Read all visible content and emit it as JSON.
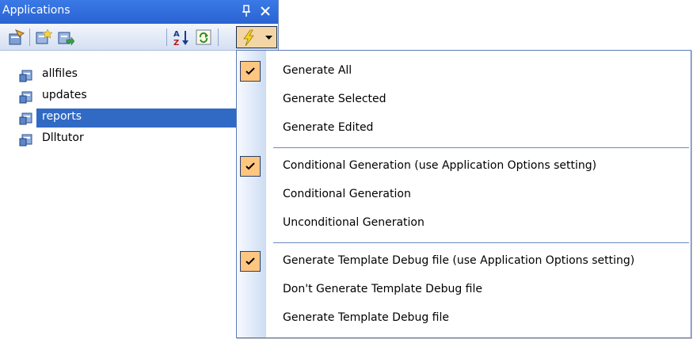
{
  "panel": {
    "title": "Applications",
    "tree_items": [
      {
        "label": "allfiles",
        "selected": false
      },
      {
        "label": "updates",
        "selected": false
      },
      {
        "label": "reports",
        "selected": true
      },
      {
        "label": "Dlltutor",
        "selected": false
      }
    ]
  },
  "toolbar": {
    "icons": [
      "properties-icon",
      "add-application-icon",
      "import-application-icon",
      "sort-az-icon",
      "refresh-icon",
      "generate-icon",
      "chevron-down-icon"
    ]
  },
  "menu": {
    "group1": [
      {
        "label": "Generate All",
        "checked": true
      },
      {
        "label": "Generate Selected",
        "checked": false
      },
      {
        "label": "Generate Edited",
        "checked": false
      }
    ],
    "group2": [
      {
        "label": "Conditional Generation (use Application Options setting)",
        "checked": true
      },
      {
        "label": "Conditional Generation",
        "checked": false
      },
      {
        "label": "Unconditional Generation",
        "checked": false
      }
    ],
    "group3": [
      {
        "label": "Generate Template Debug file (use Application Options setting)",
        "checked": true
      },
      {
        "label": "Don't Generate Template Debug file",
        "checked": false
      },
      {
        "label": "Generate Template Debug file",
        "checked": false
      }
    ]
  },
  "colors": {
    "titlebar": "#2a63d2",
    "selection": "#316ac5",
    "check_bg": "#ffc680",
    "separator": "#6a8ac0"
  }
}
